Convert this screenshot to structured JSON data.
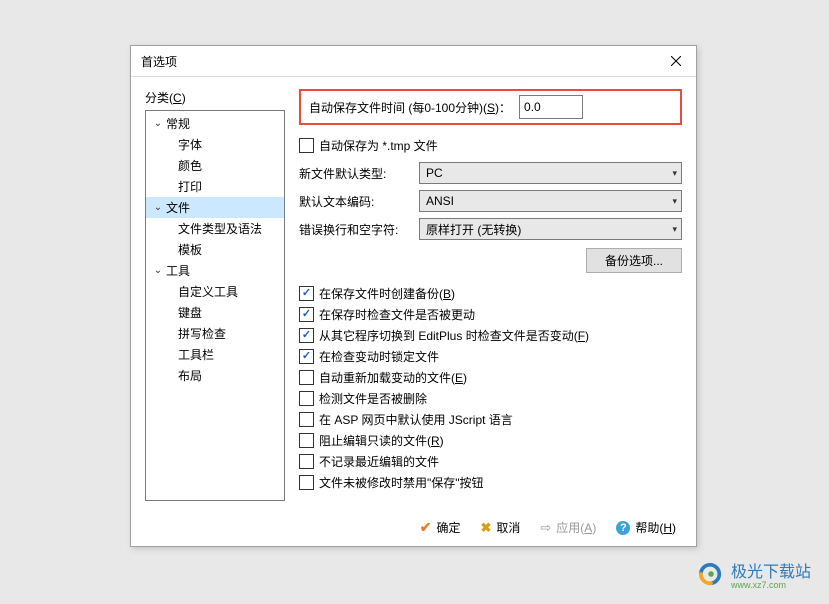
{
  "dialog": {
    "title": "首选项"
  },
  "sidebar": {
    "label": "分类",
    "label_hotkey": "C",
    "nodes": [
      {
        "label": "常规",
        "level": 1,
        "expanded": true
      },
      {
        "label": "字体",
        "level": 2
      },
      {
        "label": "颜色",
        "level": 2
      },
      {
        "label": "打印",
        "level": 2
      },
      {
        "label": "文件",
        "level": 1,
        "expanded": true,
        "selected": true
      },
      {
        "label": "文件类型及语法",
        "level": 2
      },
      {
        "label": "模板",
        "level": 2
      },
      {
        "label": "工具",
        "level": 1,
        "expanded": true
      },
      {
        "label": "自定义工具",
        "level": 2
      },
      {
        "label": "键盘",
        "level": 2
      },
      {
        "label": "拼写检查",
        "level": 2
      },
      {
        "label": "工具栏",
        "level": 2
      },
      {
        "label": "布局",
        "level": 2
      }
    ]
  },
  "content": {
    "autosave_label": "自动保存文件时间 (每0-100分钟)(S)：",
    "autosave_value": "0.0",
    "autosave_tmp": "自动保存为 *.tmp 文件",
    "new_file_type_label": "新文件默认类型:",
    "new_file_type_value": "PC",
    "default_encoding_label": "默认文本编码:",
    "default_encoding_value": "ANSI",
    "wrap_label": "错误换行和空字符:",
    "wrap_value": "原样打开 (无转换)",
    "backup_options_btn": "备份选项...",
    "checks": [
      {
        "label": "在保存文件时创建备份(B)",
        "checked": true,
        "hotkey": "B"
      },
      {
        "label": "在保存时检查文件是否被更动",
        "checked": true
      },
      {
        "label": "从其它程序切换到 EditPlus 时检查文件是否变动(F)",
        "checked": true,
        "hotkey": "F"
      },
      {
        "label": "在检查变动时锁定文件",
        "checked": true
      },
      {
        "label": "自动重新加载变动的文件(E)",
        "checked": false,
        "hotkey": "E"
      },
      {
        "label": "检测文件是否被删除",
        "checked": false
      },
      {
        "label": "在 ASP 网页中默认使用 JScript 语言",
        "checked": false
      },
      {
        "label": "阻止编辑只读的文件(R)",
        "checked": false,
        "hotkey": "R"
      },
      {
        "label": "不记录最近编辑的文件",
        "checked": false
      },
      {
        "label": "文件未被修改时禁用\"保存\"按钮",
        "checked": false
      }
    ]
  },
  "buttons": {
    "ok": "确定",
    "cancel": "取消",
    "apply": "应用",
    "apply_hotkey": "A",
    "help": "帮助",
    "help_hotkey": "H"
  },
  "watermark": {
    "text": "极光下载站",
    "sub": "www.xz7.com"
  }
}
